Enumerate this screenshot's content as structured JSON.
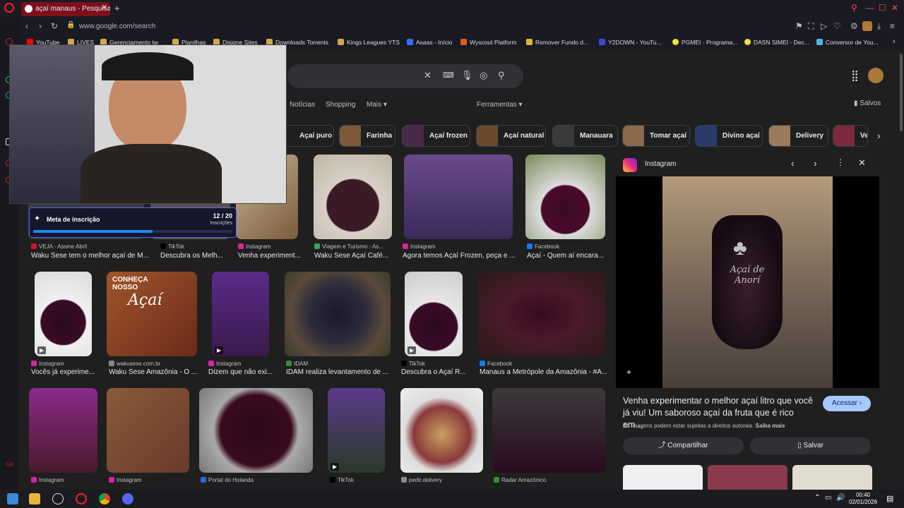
{
  "browser": {
    "tab_title": "açaí manaus - Pesquisa Go",
    "url": "www.google.com/search",
    "bookmarks": [
      "YouTube",
      "LIVES",
      "Gerenciamento tw",
      "Planilhas",
      "Disigne Sites",
      "Downloads Torrents",
      "Kings Leagues YTS",
      "Asaas - Início",
      "Wyscout Platform",
      "Remover Fundo d...",
      "Y2DOWN - YouTu...",
      "PGMEI - Programa...",
      "DASN SIMEI - Dec...",
      "Conversor de You..."
    ]
  },
  "google": {
    "tabs": [
      "Notícias",
      "Shopping",
      "Mais ▾",
      "Ferramentas ▾"
    ],
    "saved_label": "Salvos",
    "chips": [
      "Açaí puro",
      "Farinha",
      "Açaí frozen",
      "Açaí natural",
      "Manauara",
      "Tomar açaí",
      "Divino açaí",
      "Delivery",
      "Ve"
    ]
  },
  "results": [
    {
      "source": "VEJA - Assine Abril",
      "caption": "Waku Sese tem o melhor açaí de M..."
    },
    {
      "source": "TikTok",
      "caption": "Descubra os Melh..."
    },
    {
      "source": "Instagram",
      "caption": "Venha experiment..."
    },
    {
      "source": "Viagem e Turismo - As...",
      "caption": "Waku Sese Açaí Café..."
    },
    {
      "source": "Instagram",
      "caption": "Agora temos Açaí Frozen, peça e ..."
    },
    {
      "source": "Facebook",
      "caption": "Açaí - Quem aí encara..."
    },
    {
      "source": "Instagram",
      "caption": "Vocês já experime..."
    },
    {
      "source": "wakusese.com.br",
      "caption": "Waku Sese Amazônia - O ..."
    },
    {
      "source": "Instagram",
      "caption": "Dizem que não exi..."
    },
    {
      "source": "IDAM",
      "caption": "IDAM realiza levantamento de ..."
    },
    {
      "source": "TikTok",
      "caption": "Descubra o Açaí R..."
    },
    {
      "source": "Facebook",
      "caption": "Manaus a Metrópole da Amazônia - #A..."
    },
    {
      "source": "Instagram",
      "caption": ""
    },
    {
      "source": "Instagram",
      "caption": ""
    },
    {
      "source": "Portal do Holanda",
      "caption": ""
    },
    {
      "source": "TikTok",
      "caption": ""
    },
    {
      "source": "pedir.delivery",
      "caption": ""
    },
    {
      "source": "Radar Amazônico",
      "caption": ""
    }
  ],
  "tile_texts": {
    "conheca": "CONHEÇA NOSSO",
    "acai_script": "Açaí"
  },
  "preview": {
    "source": "Instagram",
    "bag_text": "Açaí de Anorí",
    "title": "Venha experimentar o melhor açaí litro que você já viu! Um saboroso açaí da fruta que é rico em...",
    "access_label": "Acessar ›",
    "rights_text": "As imagens podem estar sujeitas a direitos autorais.",
    "learn_more": "Saiba mais",
    "share_label": "Compartilhar",
    "save_label": "Salvar"
  },
  "overlay": {
    "meta_title": "Meta de inscrição",
    "meta_count": "12 / 20",
    "meta_sub": "Inscrições",
    "meta_progress": 0.6
  },
  "clock": {
    "time": "00:40",
    "date": "02/01/2026"
  },
  "colors": {
    "accent": "#ff1b2d",
    "link": "#a8c7fa",
    "progress": "#1e88ff"
  }
}
